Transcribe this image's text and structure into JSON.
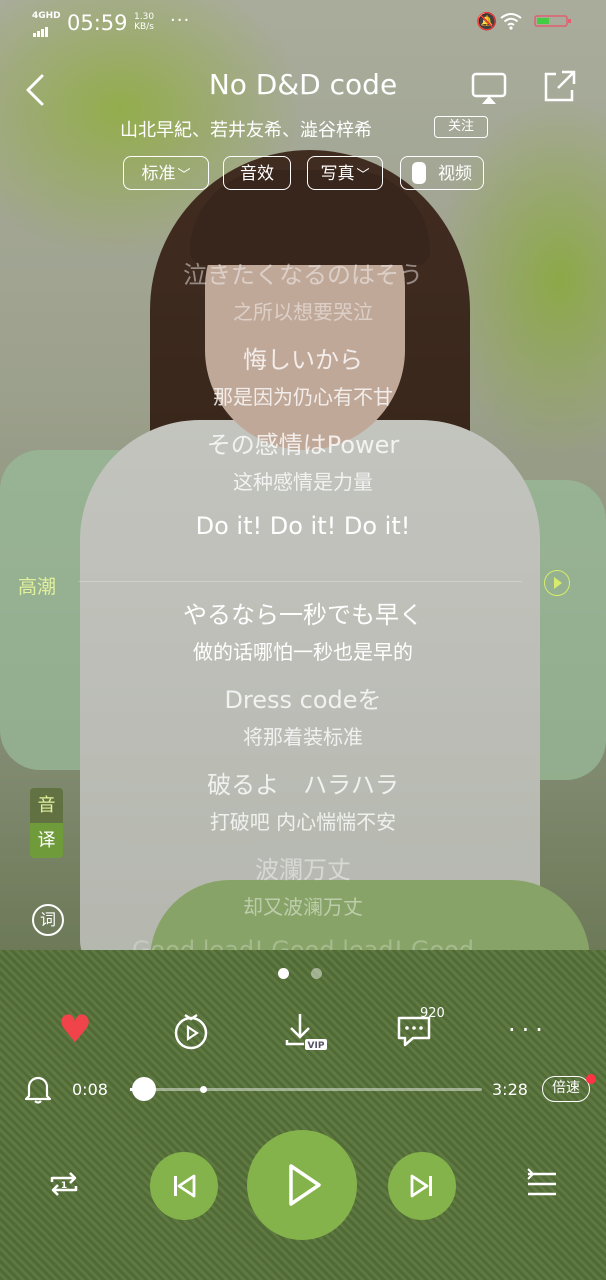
{
  "status_bar": {
    "network": "4GHD",
    "time": "05:59",
    "speed_value": "1.30",
    "speed_unit": "KB/s",
    "more": "···"
  },
  "header": {
    "title": "No D&D code",
    "artists": "山北早紀、若井友希、澁谷梓希",
    "follow": "关注"
  },
  "options": {
    "quality": "标准",
    "effects": "音效",
    "portrait": "写真",
    "video": "视频"
  },
  "lyrics": [
    {
      "jp": "泣きたくなるのはそう",
      "cn": "之所以想要哭泣"
    },
    {
      "jp": "悔しいから",
      "cn": "那是因为仍心有不甘"
    },
    {
      "jp": "その感情はPower",
      "cn": "这种感情是力量"
    },
    {
      "jp": "Do it! Do it! Do it!",
      "cn": ""
    },
    {
      "jp": "やるなら一秒でも早く",
      "cn": "做的话哪怕一秒也是早的"
    },
    {
      "jp": "Dress codeを",
      "cn": "将那着装标准"
    },
    {
      "jp": "破るよ　ハラハラ",
      "cn": "打破吧 内心惴惴不安"
    },
    {
      "jp": "波瀾万丈",
      "cn": "却又波澜万丈"
    },
    {
      "jp": "Good lead! Good lead! Good",
      "cn": ""
    }
  ],
  "climax_label": "高潮",
  "translate_toggle": {
    "yin": "音",
    "yi": "译"
  },
  "lyric_button": "词",
  "actions": {
    "comment_count": "920"
  },
  "progress": {
    "current": "0:08",
    "total": "3:28",
    "fraction": 0.04,
    "speed_label": "倍速"
  },
  "colors": {
    "accent": "#84b34b",
    "heart": "#f0444a",
    "climax": "#e1f09a"
  },
  "icons": [
    "back-icon",
    "cast-icon",
    "share-icon",
    "heart-icon",
    "tv-icon",
    "download-icon",
    "comment-icon",
    "more-icon",
    "bell-icon",
    "repeat-icon",
    "prev-icon",
    "play-icon",
    "next-icon",
    "playlist-icon"
  ]
}
